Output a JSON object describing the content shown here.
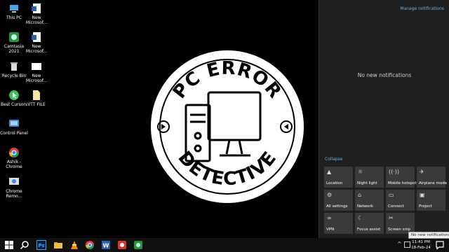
{
  "desktop": {
    "icons": [
      {
        "label": "This PC",
        "icon": "this-pc-icon"
      },
      {
        "label": "New Microsof...",
        "icon": "word-doc-icon"
      },
      {
        "label": "Camtasia 2021",
        "icon": "camtasia-icon"
      },
      {
        "label": "New Microsof...",
        "icon": "word-doc-icon"
      },
      {
        "label": "Recycle Bin",
        "icon": "recycle-bin-icon"
      },
      {
        "label": "New Microsof...",
        "icon": "blank-doc-icon"
      },
      {
        "label": "Best Cursors",
        "icon": "cursor-app-icon"
      },
      {
        "label": "VTT FILE",
        "icon": "file-icon"
      },
      {
        "label": "Control Panel",
        "icon": "control-panel-icon"
      },
      {
        "label": "Ashik - Chrome",
        "icon": "chrome-icon"
      },
      {
        "label": "Chrome Remo...",
        "icon": "chrome-remote-icon"
      }
    ]
  },
  "wallpaper": {
    "top_text": "PC ERROR",
    "bottom_text": "DETECTIVE"
  },
  "action_center": {
    "manage_label": "Manage notifications",
    "empty_label": "No new notifications",
    "collapse_label": "Collapse",
    "tiles": [
      {
        "label": "Location",
        "icon": "location-icon",
        "glyph": "▲"
      },
      {
        "label": "Night light",
        "icon": "night-light-icon",
        "glyph": "☼"
      },
      {
        "label": "Mobile hotspot",
        "icon": "hotspot-icon",
        "glyph": "((·))"
      },
      {
        "label": "Airplane mode",
        "icon": "airplane-icon",
        "glyph": "✈"
      },
      {
        "label": "All settings",
        "icon": "settings-icon",
        "glyph": "⚙"
      },
      {
        "label": "Network",
        "icon": "network-icon",
        "glyph": "⌂"
      },
      {
        "label": "Connect",
        "icon": "connect-icon",
        "glyph": "▭"
      },
      {
        "label": "Project",
        "icon": "project-icon",
        "glyph": "▣"
      },
      {
        "label": "VPN",
        "icon": "vpn-icon",
        "glyph": "∞"
      },
      {
        "label": "Focus assist",
        "icon": "focus-assist-icon",
        "glyph": "☾"
      },
      {
        "label": "Screen snip",
        "icon": "screen-snip-icon",
        "glyph": "✂"
      }
    ]
  },
  "taskbar": {
    "time": "11:41 PM",
    "date": "18-Feb-24",
    "tooltip": "No new notifications"
  }
}
